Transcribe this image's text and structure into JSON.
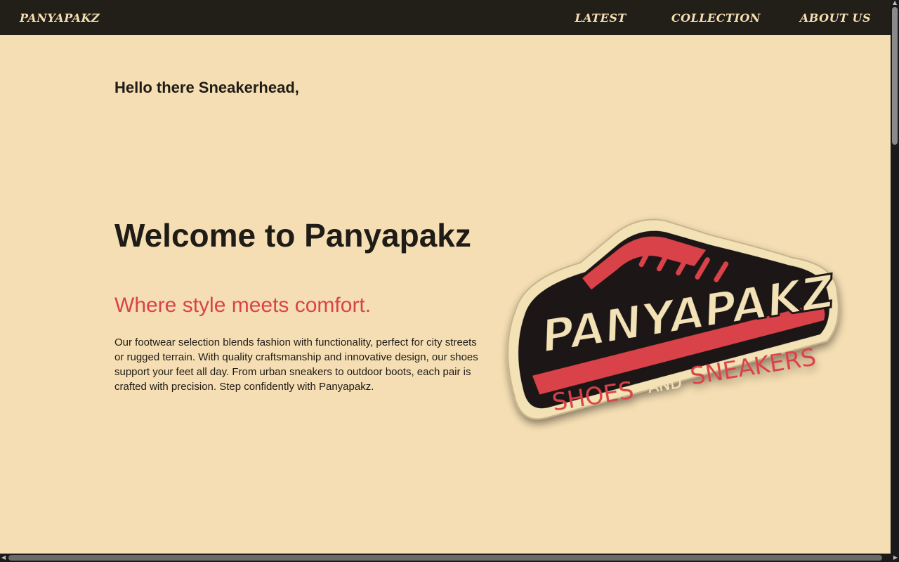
{
  "nav": {
    "brand": "PANYAPAKZ",
    "links": [
      "LATEST",
      "COLLECTION",
      "ABOUT US"
    ]
  },
  "hero": {
    "greeting": "Hello there Sneakerhead,",
    "title": "Welcome to Panyapakz",
    "tagline": "Where style meets comfort.",
    "description": "Our footwear selection blends fashion with functionality, perfect for city streets or rugged terrain. With quality craftsmanship and innovative design, our shoes support your feet all day. From urban sneakers to outdoor boots, each pair is crafted with precision. Step confidently with Panyapakz."
  },
  "logo": {
    "wordmark": "PANYAPAKZ",
    "line_left": "SHOES",
    "line_mid": "AND",
    "line_right": "SNEAKERS"
  },
  "colors": {
    "background": "#f5deb3",
    "navbar": "#221e18",
    "accent": "#d9434a",
    "text": "#1f1b16"
  }
}
